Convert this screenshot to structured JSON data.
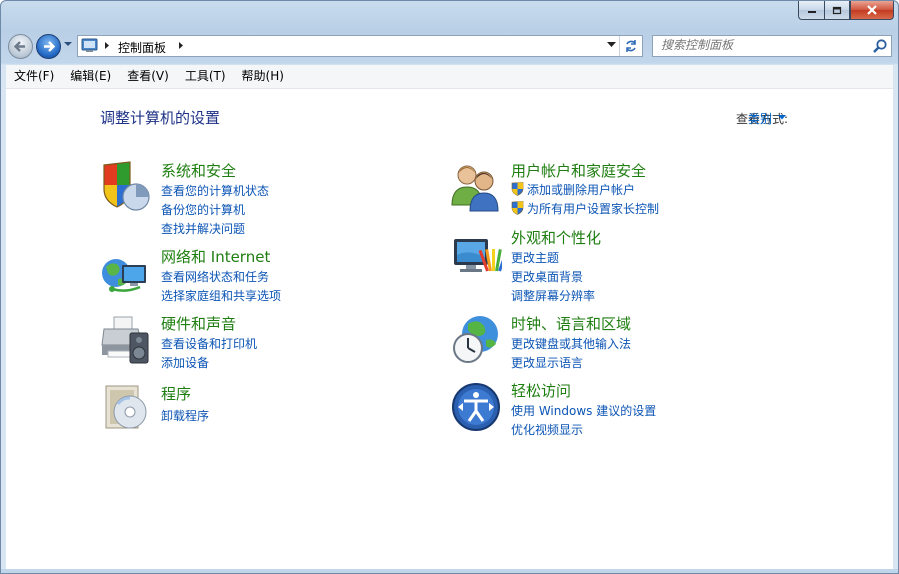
{
  "window": {
    "address": {
      "breadcrumb": "控制面板"
    },
    "search": {
      "placeholder": "搜索控制面板"
    }
  },
  "menubar": [
    {
      "label": "文件(F)"
    },
    {
      "label": "编辑(E)"
    },
    {
      "label": "查看(V)"
    },
    {
      "label": "工具(T)"
    },
    {
      "label": "帮助(H)"
    }
  ],
  "content": {
    "title": "调整计算机的设置",
    "view_by_label": "查看方式:",
    "view_by_value": "类别",
    "categories": [
      {
        "title": "系统和安全",
        "icon": "shield-pie-icon",
        "links": [
          "查看您的计算机状态",
          "备份您的计算机",
          "查找并解决问题"
        ]
      },
      {
        "title": "网络和 Internet",
        "icon": "globe-network-icon",
        "links": [
          "查看网络状态和任务",
          "选择家庭组和共享选项"
        ]
      },
      {
        "title": "硬件和声音",
        "icon": "printer-speaker-icon",
        "links": [
          "查看设备和打印机",
          "添加设备"
        ]
      },
      {
        "title": "程序",
        "icon": "programs-disc-icon",
        "links": [
          "卸载程序"
        ]
      },
      {
        "title": "用户帐户和家庭安全",
        "icon": "users-icon",
        "links": [
          "添加或删除用户帐户",
          "为所有用户设置家长控制"
        ]
      },
      {
        "title": "外观和个性化",
        "icon": "monitor-palette-icon",
        "links": [
          "更改主题",
          "更改桌面背景",
          "调整屏幕分辨率"
        ]
      },
      {
        "title": "时钟、语言和区域",
        "icon": "globe-clock-icon",
        "links": [
          "更改键盘或其他输入法",
          "更改显示语言"
        ]
      },
      {
        "title": "轻松访问",
        "icon": "ease-of-access-icon",
        "links": [
          "使用 Windows 建议的设置",
          "优化视频显示"
        ]
      }
    ]
  }
}
